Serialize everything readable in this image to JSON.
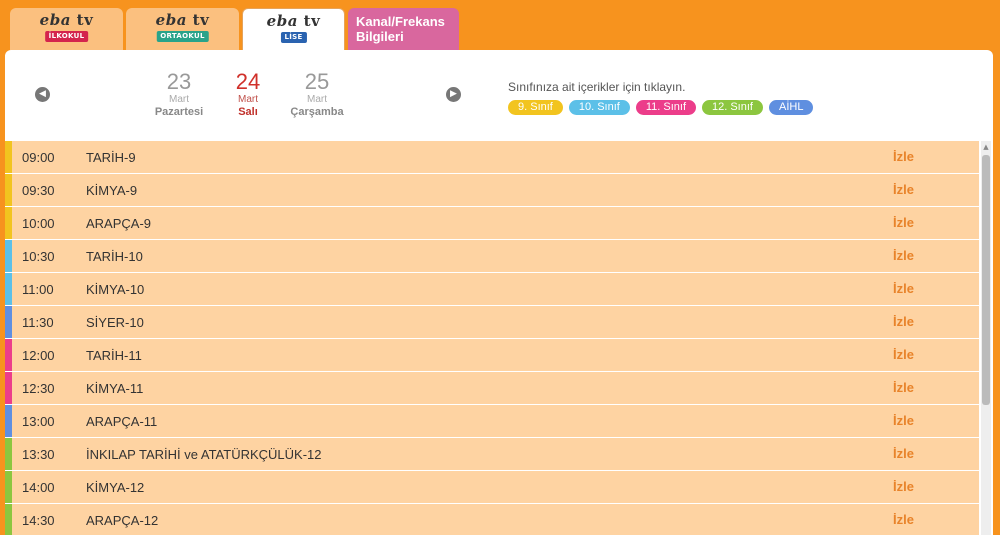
{
  "tabs": [
    {
      "logo": "eba tv",
      "badge": "İLKOKUL",
      "badge_color": "#d4244d"
    },
    {
      "logo": "eba tv",
      "badge": "ORTAOKUL",
      "badge_color": "#29a38a"
    },
    {
      "logo": "eba tv",
      "badge": "LİSE",
      "badge_color": "#2a63b0"
    },
    {
      "label_line1": "Kanal/Frekans",
      "label_line2": "Bilgileri"
    }
  ],
  "dates": [
    {
      "day": "23",
      "month": "Mart",
      "weekday": "Pazartesi"
    },
    {
      "day": "24",
      "month": "Mart",
      "weekday": "Salı"
    },
    {
      "day": "25",
      "month": "Mart",
      "weekday": "Çarşamba"
    }
  ],
  "nav": {
    "prev_icon": "chevron-left-icon",
    "next_icon": "chevron-right-icon"
  },
  "hint": "Sınıfınıza ait içerikler için tıklayın.",
  "chips": [
    {
      "label": "9. Sınıf",
      "color": "#f2c41f"
    },
    {
      "label": "10. Sınıf",
      "color": "#5cc0e8"
    },
    {
      "label": "11. Sınıf",
      "color": "#ec3d8a"
    },
    {
      "label": "12. Sınıf",
      "color": "#8cc63f"
    },
    {
      "label": "AİHL",
      "color": "#5f8fe0"
    }
  ],
  "schedule": [
    {
      "time": "09:00",
      "title": "TARİH-9",
      "action": "İzle",
      "color": "#f2c41f"
    },
    {
      "time": "09:30",
      "title": "KİMYA-9",
      "action": "İzle",
      "color": "#f2c41f"
    },
    {
      "time": "10:00",
      "title": "ARAPÇA-9",
      "action": "İzle",
      "color": "#f2c41f"
    },
    {
      "time": "10:30",
      "title": "TARİH-10",
      "action": "İzle",
      "color": "#5cc0e8"
    },
    {
      "time": "11:00",
      "title": "KİMYA-10",
      "action": "İzle",
      "color": "#5cc0e8"
    },
    {
      "time": "11:30",
      "title": "SİYER-10",
      "action": "İzle",
      "color": "#5f8fe0"
    },
    {
      "time": "12:00",
      "title": "TARİH-11",
      "action": "İzle",
      "color": "#ec3d8a"
    },
    {
      "time": "12:30",
      "title": "KİMYA-11",
      "action": "İzle",
      "color": "#ec3d8a"
    },
    {
      "time": "13:00",
      "title": "ARAPÇA-11",
      "action": "İzle",
      "color": "#5f8fe0"
    },
    {
      "time": "13:30",
      "title": "İNKILAP TARİHİ ve ATATÜRKÇÜLÜK-12",
      "action": "İzle",
      "color": "#8cc63f"
    },
    {
      "time": "14:00",
      "title": "KİMYA-12",
      "action": "İzle",
      "color": "#8cc63f"
    },
    {
      "time": "14:30",
      "title": "ARAPÇA-12",
      "action": "İzle",
      "color": "#8cc63f"
    }
  ]
}
